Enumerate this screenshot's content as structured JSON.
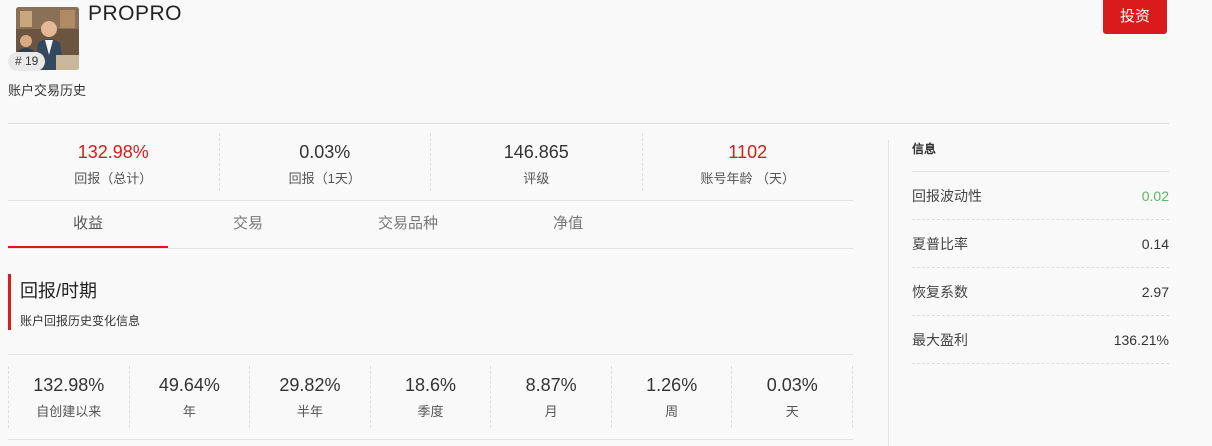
{
  "header": {
    "account_name": "PROPRO",
    "rank": "# 19",
    "history_link": "账户交易历史",
    "invest_label": "投资"
  },
  "summary": [
    {
      "value": "132.98%",
      "label": "回报（总计）",
      "color": "#d91b1b"
    },
    {
      "value": "0.03%",
      "label": "回报（1天）",
      "color": "#333333"
    },
    {
      "value": "146.865",
      "label": "评级",
      "color": "#333333"
    },
    {
      "value": "1102",
      "label": "账号年龄 （天）",
      "color": "#d91b1b"
    }
  ],
  "tabs": [
    {
      "label": "收益",
      "active": true
    },
    {
      "label": "交易",
      "active": false
    },
    {
      "label": "交易品种",
      "active": false
    },
    {
      "label": "净值",
      "active": false
    }
  ],
  "section": {
    "title": "回报/时期",
    "subtitle": "账户回报历史变化信息"
  },
  "periods": [
    {
      "value": "132.98%",
      "label": "自创建以来"
    },
    {
      "value": "49.64%",
      "label": "年"
    },
    {
      "value": "29.82%",
      "label": "半年"
    },
    {
      "value": "18.6%",
      "label": "季度"
    },
    {
      "value": "8.87%",
      "label": "月"
    },
    {
      "value": "1.26%",
      "label": "周"
    },
    {
      "value": "0.03%",
      "label": "天"
    }
  ],
  "info": {
    "title": "信息",
    "rows": [
      {
        "label": "回报波动性",
        "value": "0.02",
        "color": "#5cb85c"
      },
      {
        "label": "夏普比率",
        "value": "0.14",
        "color": "#333333"
      },
      {
        "label": "恢复系数",
        "value": "2.97",
        "color": "#333333"
      },
      {
        "label": "最大盈利",
        "value": "136.21%",
        "color": "#333333"
      }
    ]
  },
  "colors": {
    "accent": "#d91b1b",
    "positive": "#5cb85c"
  }
}
